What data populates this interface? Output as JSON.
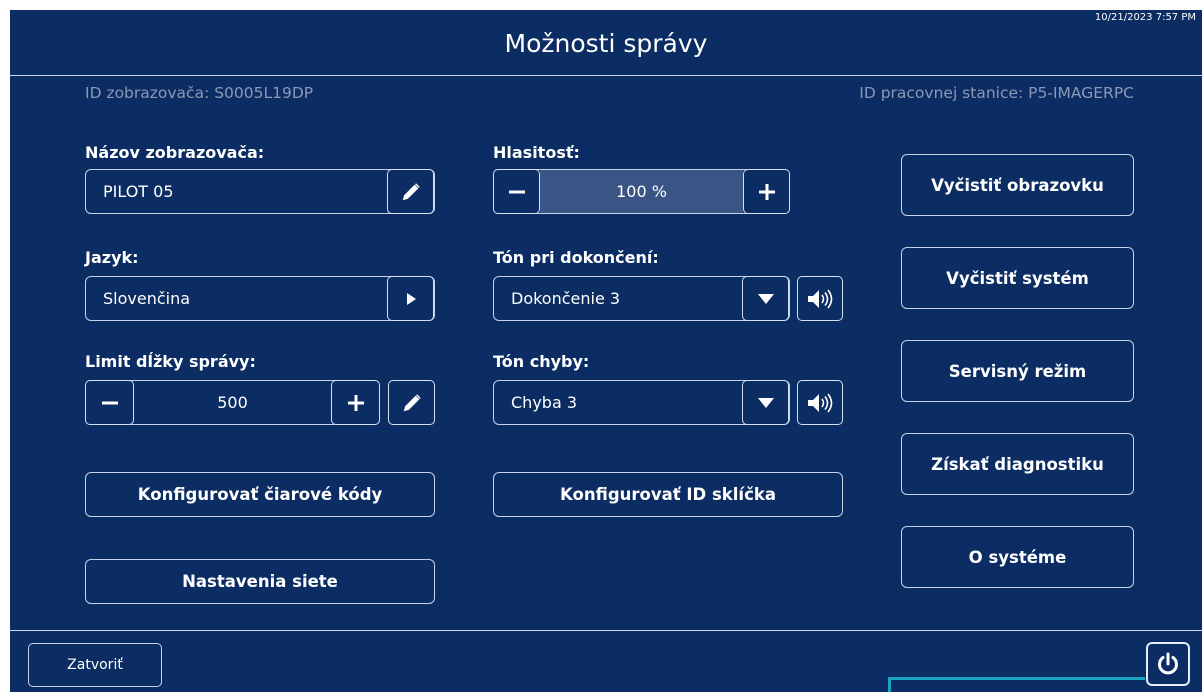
{
  "header": {
    "title": "Možnosti správy",
    "datetime": "10/21/2023 7:57 PM",
    "viewer_id": "ID zobrazovača: S0005L19DP",
    "workstation_id": "ID pracovnej stanice: P5-IMAGERPC"
  },
  "fields": {
    "viewer_name": {
      "label": "Názov zobrazovača:",
      "value": "PILOT 05"
    },
    "language": {
      "label": "Jazyk:",
      "value": "Slovenčina"
    },
    "message_limit": {
      "label": "Limit dĺžky správy:",
      "value": "500"
    },
    "volume": {
      "label": "Hlasitosť:",
      "value": "100 %",
      "level_percent": 100
    },
    "completion_tone": {
      "label": "Tón pri dokončení:",
      "value": "Dokončenie 3"
    },
    "error_tone": {
      "label": "Tón chyby:",
      "value": "Chyba 3"
    }
  },
  "buttons": {
    "configure_barcodes": "Konfigurovať čiarové kódy",
    "configure_slide_id": "Konfigurovať ID sklíčka",
    "network_settings": "Nastavenia siete",
    "clear_screen": "Vyčistiť obrazovku",
    "clear_system": "Vyčistiť systém",
    "service_mode": "Servisný režim",
    "get_diagnostics": "Získať diagnostiku",
    "about_system": "O systéme",
    "close": "Zatvoriť"
  },
  "icons": {
    "edit": "pencil-icon",
    "next": "play-arrow-icon",
    "minus": "minus-icon",
    "plus": "plus-icon",
    "dropdown": "caret-down-icon",
    "speaker": "speaker-icon",
    "power": "power-icon"
  },
  "colors": {
    "background": "#0c2d63",
    "text": "#ffffff",
    "muted_text": "#8c98b5",
    "border": "#c8d2e6",
    "volume_fill": "#3a5585",
    "highlight_line": "#1aa3c2"
  }
}
